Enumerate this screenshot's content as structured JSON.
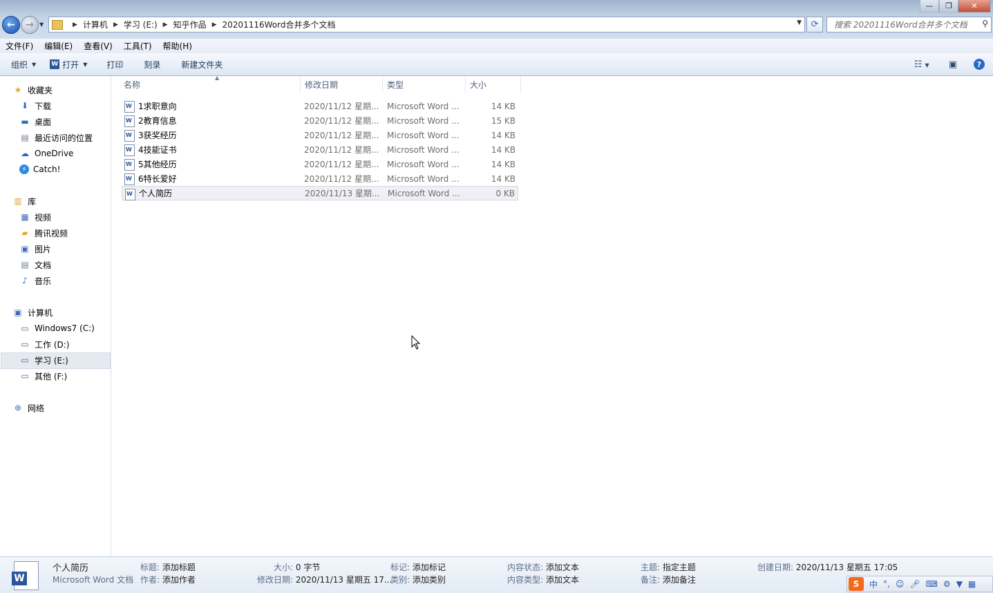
{
  "address": {
    "crumbs": [
      "计算机",
      "学习 (E:)",
      "知乎作品",
      "20201116Word合并多个文档"
    ],
    "search_placeholder": "搜索 20201116Word合并多个文档"
  },
  "menu": [
    "文件(F)",
    "编辑(E)",
    "查看(V)",
    "工具(T)",
    "帮助(H)"
  ],
  "toolbar": {
    "organize": "组织",
    "open": "打开",
    "print": "打印",
    "burn": "刻录",
    "new_folder": "新建文件夹"
  },
  "sidebar": {
    "favorites": "收藏夹",
    "fav_items": [
      "下载",
      "桌面",
      "最近访问的位置"
    ],
    "onedrive": "OneDrive",
    "catch": "Catch!",
    "libraries": "库",
    "lib_items": [
      "视频",
      "腾讯视频",
      "图片",
      "文档",
      "音乐"
    ],
    "computer": "计算机",
    "drives": [
      "Windows7 (C:)",
      "工作 (D:)",
      "学习 (E:)",
      "其他 (F:)"
    ],
    "network": "网络"
  },
  "columns": {
    "name": "名称",
    "date": "修改日期",
    "type": "类型",
    "size": "大小"
  },
  "files": [
    {
      "name": "1求职意向",
      "date": "2020/11/12 星期...",
      "type": "Microsoft Word ...",
      "size": "14 KB"
    },
    {
      "name": "2教育信息",
      "date": "2020/11/12 星期...",
      "type": "Microsoft Word ...",
      "size": "15 KB"
    },
    {
      "name": "3获奖经历",
      "date": "2020/11/12 星期...",
      "type": "Microsoft Word ...",
      "size": "14 KB"
    },
    {
      "name": "4技能证书",
      "date": "2020/11/12 星期...",
      "type": "Microsoft Word ...",
      "size": "14 KB"
    },
    {
      "name": "5其他经历",
      "date": "2020/11/12 星期...",
      "type": "Microsoft Word ...",
      "size": "14 KB"
    },
    {
      "name": "6特长爱好",
      "date": "2020/11/12 星期...",
      "type": "Microsoft Word ...",
      "size": "14 KB"
    },
    {
      "name": "个人简历",
      "date": "2020/11/13 星期...",
      "type": "Microsoft Word ...",
      "size": "0 KB"
    }
  ],
  "details": {
    "filename": "个人简历",
    "filetype": "Microsoft Word 文档",
    "title_label": "标题:",
    "title_value": "添加标题",
    "author_label": "作者:",
    "author_value": "添加作者",
    "size_label": "大小:",
    "size_value": "0 字节",
    "modified_label": "修改日期:",
    "modified_value": "2020/11/13 星期五 17...",
    "tags_label": "标记:",
    "tags_value": "添加标记",
    "category_label": "类别:",
    "category_value": "添加类别",
    "content_status_label": "内容状态:",
    "content_status_value": "添加文本",
    "content_type_label": "内容类型:",
    "content_type_value": "添加文本",
    "subject_label": "主题:",
    "subject_value": "指定主题",
    "comments_label": "备注:",
    "comments_value": "添加备注",
    "created_label": "创建日期:",
    "created_value": "2020/11/13 星期五 17:05"
  },
  "tray": {
    "ime": "中"
  }
}
